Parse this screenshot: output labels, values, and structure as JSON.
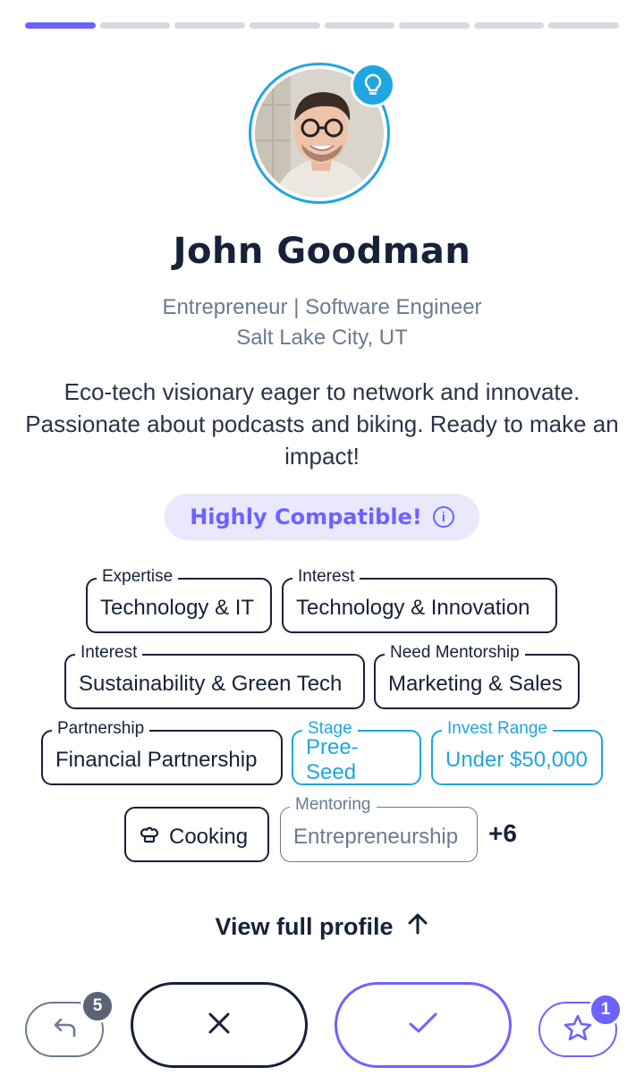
{
  "progress": {
    "total_steps": 8,
    "current_step": 1
  },
  "profile": {
    "name": "John Goodman",
    "role": "Entrepreneur | Software Engineer",
    "location": "Salt Lake City, UT",
    "bio": "Eco-tech visionary eager to network and innovate. Passionate about podcasts and biking. Ready to make an impact!"
  },
  "compatibility": {
    "label": "Highly Compatible!"
  },
  "tags": [
    {
      "label": "Expertise",
      "value": "Technology & IT"
    },
    {
      "label": "Interest",
      "value": "Technology & Innovation"
    },
    {
      "label": "Interest",
      "value": "Sustainability & Green Tech"
    },
    {
      "label": "Need Mentorship",
      "value": "Marketing & Sales"
    },
    {
      "label": "Partnership",
      "value": "Financial Partnership"
    },
    {
      "label": "Stage",
      "value": "Pree-Seed"
    },
    {
      "label": "Invest Range",
      "value": "Under $50,000"
    },
    {
      "label": "",
      "value": "Cooking"
    },
    {
      "label": "Mentoring",
      "value": "Entrepreneurship"
    }
  ],
  "more_tags": "+6",
  "view_profile": {
    "label": "View full profile"
  },
  "actions": {
    "undo_count": "5",
    "favorite_count": "1"
  },
  "colors": {
    "accent_purple": "#6c63ff",
    "accent_blue": "#1fa6e0",
    "text_dark": "#16213a",
    "text_muted": "#6b7a90",
    "undo_badge": "#5b6474"
  },
  "icons": [
    "lightbulb-icon",
    "info-icon",
    "chef-hat-icon",
    "arrow-up-icon",
    "undo-arrow-icon",
    "close-icon",
    "check-icon",
    "star-icon"
  ]
}
